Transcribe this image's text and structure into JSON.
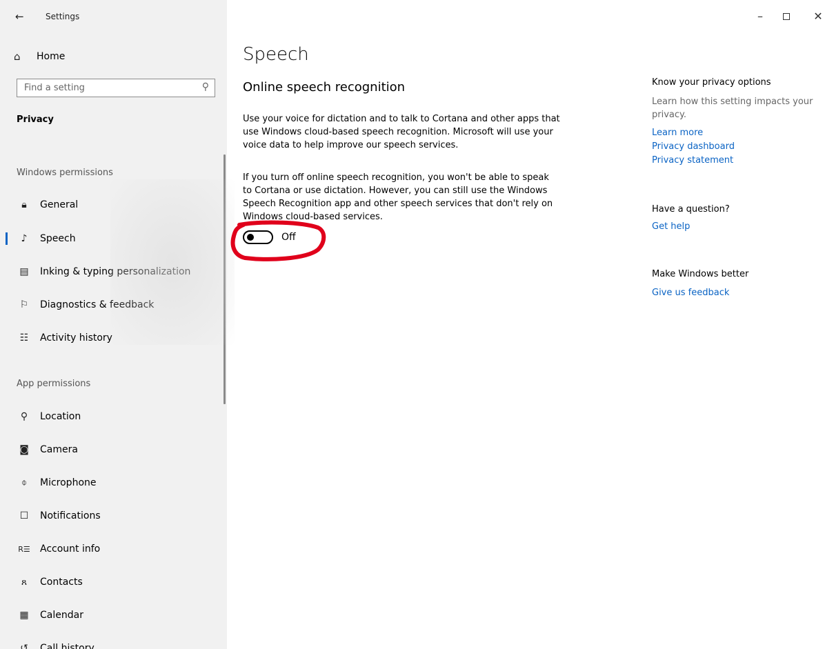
{
  "window": {
    "title": "Settings",
    "controls": {
      "minimize": "–",
      "maximize": "",
      "close": "✕"
    }
  },
  "sidebar": {
    "home_label": "Home",
    "search_placeholder": "Find a setting",
    "category": "Privacy",
    "sections": [
      {
        "title": "Windows permissions",
        "items": [
          {
            "label": "General",
            "icon": "lock-icon"
          },
          {
            "label": "Speech",
            "icon": "speech-icon",
            "selected": true
          },
          {
            "label": "Inking & typing personalization",
            "icon": "clipboard-icon"
          },
          {
            "label": "Diagnostics & feedback",
            "icon": "feedback-icon"
          },
          {
            "label": "Activity history",
            "icon": "activity-icon"
          }
        ]
      },
      {
        "title": "App permissions",
        "items": [
          {
            "label": "Location",
            "icon": "location-icon"
          },
          {
            "label": "Camera",
            "icon": "camera-icon"
          },
          {
            "label": "Microphone",
            "icon": "microphone-icon"
          },
          {
            "label": "Notifications",
            "icon": "notifications-icon"
          },
          {
            "label": "Account info",
            "icon": "account-info-icon"
          },
          {
            "label": "Contacts",
            "icon": "contacts-icon"
          },
          {
            "label": "Calendar",
            "icon": "calendar-icon"
          },
          {
            "label": "Call history",
            "icon": "call-history-icon"
          }
        ]
      }
    ]
  },
  "main": {
    "title": "Speech",
    "section_title": "Online speech recognition",
    "paragraph1": "Use your voice for dictation and to talk to Cortana and other apps that use Windows cloud-based speech recognition. Microsoft will use your voice data to help improve our speech services.",
    "paragraph2": "If you turn off online speech recognition, you won't be able to speak to Cortana or use dictation. However, you can still use the Windows Speech Recognition app and other speech services that don't rely on Windows cloud-based services.",
    "toggle": {
      "state": "off",
      "label": "Off"
    },
    "annotation_color": "#e0001b"
  },
  "right_panel": {
    "privacy_heading": "Know your privacy options",
    "privacy_text": "Learn how this setting impacts your privacy.",
    "links": [
      "Learn more",
      "Privacy dashboard",
      "Privacy statement"
    ],
    "question_heading": "Have a question?",
    "help_link": "Get help",
    "better_heading": "Make Windows better",
    "feedback_link": "Give us feedback"
  },
  "colors": {
    "accent": "#0a63c4",
    "sidebar_bg": "#f1f1f1"
  }
}
